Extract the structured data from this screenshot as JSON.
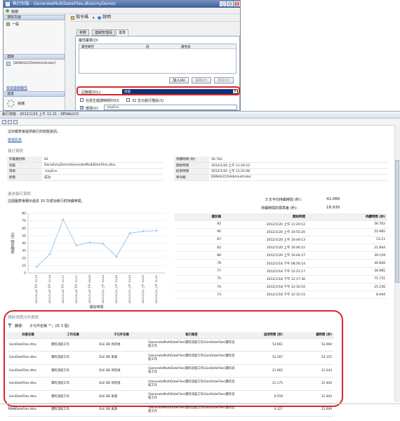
{
  "dialog": {
    "title": "執行封裝 - GenerateMultiDateFiles.dtsx(myDemo)",
    "left": {
      "section_select_page": "選取頁面",
      "page_general": "一般",
      "ready_label": "就緒",
      "section_connection": "連線",
      "connection_user": "[DENALI\\CO\\Administrator]",
      "link_view_connection": "檢視連線屬性",
      "section_progress": "進度",
      "progress_status": "就緒"
    },
    "toolbar": {
      "script": "指令碼",
      "help": "說明"
    },
    "tabs": [
      "參數",
      "連線管理員",
      "進階"
    ],
    "property_override_label": "屬性覆寫(O)",
    "property_columns": [
      "屬性路徑",
      "值",
      "屬性值"
    ],
    "buttons": {
      "add": "加入(A)",
      "edit": "編輯(E)",
      "remove": "移除(R)"
    },
    "logging_level_label": "記錄層次(L):",
    "logging_level_value": "效能",
    "dump_on_errors_label": "在發生錯誤時傾印(D)",
    "runtime_32bit_label": "32 位元執行階段(3)",
    "environment_label": "環境(V):",
    "environment_value": ".\\myEnv"
  },
  "report": {
    "title": "執行效能 - 2012/1/20 上午 11:21 - DENALICO",
    "intro": "這份報表會提供執行的效能資訊。",
    "link_view_messages": "檢視訊息",
    "section_exec_info": "執行資訊",
    "exec_info_left": [
      {
        "k": "作業識別碼",
        "v": "92"
      },
      {
        "k": "封裝",
        "v": "Denali\\myDemo\\GenerateMultiDateFiles.dtsx"
      },
      {
        "k": "環境",
        "v": ".\\myEnv"
      },
      {
        "k": "狀態",
        "v": "成功"
      }
    ],
    "exec_info_right": [
      {
        "k": "持續時間 (秒)",
        "v": "56.762"
      },
      {
        "k": "開始時間",
        "v": "2012/1/20 上午 11:20:12"
      },
      {
        "k": "結束時間",
        "v": "2012/1/20 上午 11:21:08"
      },
      {
        "k": "呼叫端",
        "v": "DENALI\\CO\\Administrator"
      }
    ],
    "section_past": "過去執行資訊",
    "past_note": "這個圖表會顯示過去 10 次成功執行的持續時間。",
    "avg_label": "3 次平均持續時間 (秒)：",
    "avg_value": "41.066",
    "std_label": "持續時間的標準差 (秒)：",
    "std_value": "18.930",
    "hist_headers": [
      "識別碼",
      "開始時間",
      "持續時間 (秒)"
    ],
    "hist_rows": [
      [
        "92",
        "2012/1/20 上午 11:20:12",
        "56.762"
      ],
      [
        "90",
        "2012/1/20 上午 10:55:20",
        "55.985"
      ],
      [
        "87",
        "2012/1/20 上午 10:49:13",
        "53.11"
      ],
      [
        "82",
        "2012/1/20 上午 10:46:22",
        "21.844"
      ],
      [
        "80",
        "2012/1/20 上午 10:44:27",
        "39.159"
      ],
      [
        "78",
        "2012/1/18 下午 08:56:14",
        "40.828"
      ],
      [
        "77",
        "2012/1/18 下午 12:21:17",
        "36.985"
      ],
      [
        "75",
        "2012/1/18 下午 12:17:36",
        "71.731"
      ],
      [
        "74",
        "2012/1/18 下午 12:16:10",
        "25.156"
      ],
      [
        "73",
        "2012/1/18 下午 12:15:15",
        "8.094"
      ]
    ],
    "section_components": "資料流程元件資訊",
    "filter_label": "篩選：",
    "filter_value": "子元件名稱 \"\"；(共 3 個)",
    "comp_headers": [
      "封裝名稱",
      "工作名稱",
      "子元件名稱",
      "執行路徑",
      "啟用時間 (秒)",
      "總時間 (秒)"
    ],
    "comp_rows": [
      [
        "GenDateFiles.dtsx",
        "資料流程工作",
        "OLE DB 目的地",
        "\\GenerateMultiDateFiles\\資料流程工作\\GenDateFiles\\資料流程工作",
        "53.661",
        "53.969"
      ],
      [
        "GenDateFiles.dtsx",
        "資料流程工作",
        "OLE DB 來源",
        "\\GenerateMultiDateFiles\\資料流程工作\\GenDateFiles\\資料流程工作",
        "52.267",
        "54.125"
      ],
      [
        "GenDateFiles.dtsx",
        "資料流程工作",
        "OLE DB 目的地",
        "\\GenerateMultiDateFiles\\資料流程工作\\GenDateFiles\\資料流程工作",
        "21.062",
        "21.543"
      ],
      [
        "GenDateFiles.dtsx",
        "資料流程工作",
        "OLE DB 目的地",
        "\\GenerateMultiDateFiles\\資料流程工作\\GenDateFiles\\資料流程工作",
        "21.175",
        "21.404"
      ],
      [
        "GenDateFiles.dtsx",
        "資料流程工作",
        "OLE DB 來源",
        "\\GenerateMultiDateFiles\\資料流程工作\\GenDateFiles\\資料流程工作",
        "0.559",
        "21.404"
      ],
      [
        "GenDateFiles.dtsx",
        "資料流程工作",
        "OLE DB 來源",
        "\\GenerateMultiDateFiles\\資料流程工作\\GenDateFiles\\資料流程工作",
        "0.327",
        "21.609"
      ]
    ],
    "page_indicator": "1 / 1",
    "colors": {
      "highlight": "#d8262a",
      "selection": "#0c2d8a",
      "chart_line": "#9fc7ec"
    }
  },
  "chart_data": {
    "type": "line",
    "title": "",
    "xlabel": "開始時間",
    "ylabel": "持續時間 (秒)",
    "ylim": [
      0,
      80
    ],
    "yticks": [
      0,
      10,
      20,
      30,
      40,
      50,
      60,
      70,
      80
    ],
    "categories": [
      "2012/1/18 下午 12:15",
      "2012/1/18 下午 12:16",
      "2012/1/18 下午 12:17",
      "2012/1/18 下午 12:21",
      "2012/1/18 下午 08:56",
      "2012/1/20 上午 10:44",
      "2012/1/20 上午 10:46",
      "2012/1/20 上午 10:49",
      "2012/1/20 上午 10:55",
      "2012/1/20 上午 11:20"
    ],
    "series": [
      {
        "values": [
          8.094,
          25.156,
          71.731,
          36.985,
          40.828,
          39.159,
          21.844,
          53.11,
          55.985,
          56.762
        ]
      }
    ],
    "grid": true
  }
}
